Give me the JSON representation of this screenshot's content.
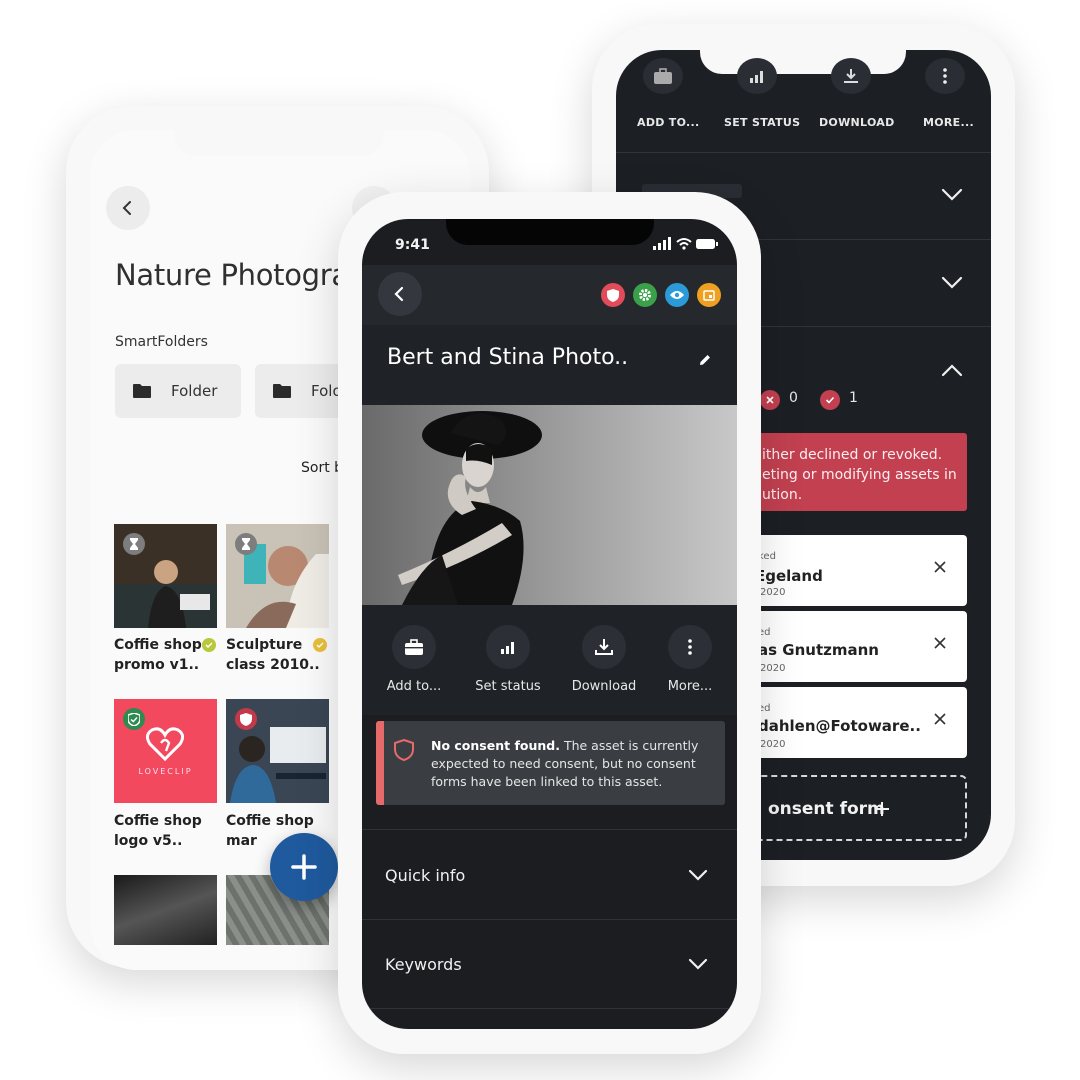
{
  "left_phone": {
    "title": "Nature Photogra",
    "smartfolders_label": "SmartFolders",
    "folders": [
      "Folder",
      "Folo"
    ],
    "sort_label": "Sort b",
    "thumbnails": [
      {
        "line1": "Coffie shop",
        "line2": "promo v1..",
        "badge": "hourglass-icon"
      },
      {
        "line1": "Sculpture",
        "line2": "class 2010..",
        "badge": "hourglass-icon"
      },
      {
        "line1": "Coffie shop",
        "line2": "logo v5..",
        "badge": "shield-check-icon",
        "brand": "LOVECLIP"
      },
      {
        "line1": "Coffie shop",
        "line2": "mar",
        "badge": "shield-icon"
      }
    ]
  },
  "center_phone": {
    "status_time": "9:41",
    "title": "Bert and Stina Photo..",
    "header_badges": [
      {
        "name": "shield-icon",
        "color": "#e24b5a"
      },
      {
        "name": "gear-icon",
        "color": "#3aa14a"
      },
      {
        "name": "eye-icon",
        "color": "#2a9bd8"
      },
      {
        "name": "calendar-icon",
        "color": "#f0a020"
      }
    ],
    "actions": [
      "Add to...",
      "Set status",
      "Download",
      "More..."
    ],
    "alert": {
      "bold": "No consent found.",
      "text": " The asset is currently expected to need consent, but no consent forms have been linked to this asset."
    },
    "accordions": [
      "Quick info",
      "Keywords"
    ]
  },
  "right_phone": {
    "actions": [
      "ADD TO...",
      "SET STATUS",
      "DOWNLOAD",
      "MORE..."
    ],
    "counts": {
      "declined": "0",
      "approved": "1"
    },
    "alert_lines": [
      "ither declined or revoked.",
      "eting or modifying assets in",
      "ution."
    ],
    "cards": [
      {
        "label": "ked",
        "name": "Egeland",
        "date": "2020"
      },
      {
        "label": "ed",
        "name": "as Gnutzmann",
        "date": "2020"
      },
      {
        "label": "ed",
        "name": "dahlen@Fotoware..",
        "date": "2020"
      }
    ],
    "add_form_label": "onsent form"
  }
}
